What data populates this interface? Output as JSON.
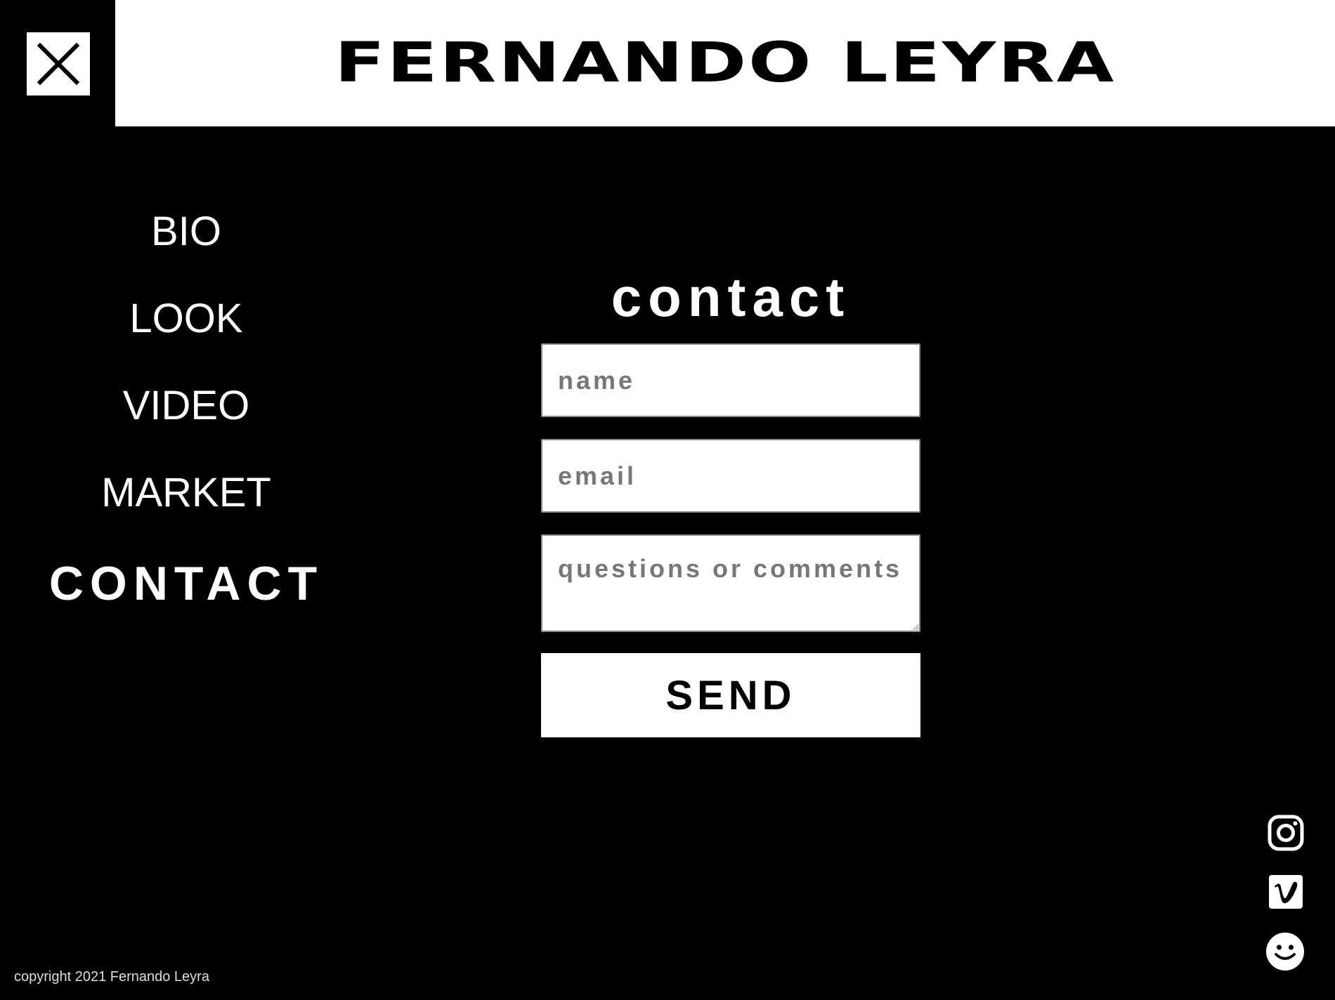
{
  "header": {
    "title": "FERNANDO LEYRA"
  },
  "nav": {
    "items": [
      {
        "label": "BIO"
      },
      {
        "label": "LOOK"
      },
      {
        "label": "VIDEO"
      },
      {
        "label": "MARKET"
      },
      {
        "label": "CONTACT"
      }
    ]
  },
  "contact_form": {
    "title": "contact",
    "name_placeholder": "name",
    "email_placeholder": "email",
    "comments_placeholder": "questions or comments",
    "send_label": "SEND"
  },
  "social": {
    "icons": [
      "instagram-icon",
      "vimeo-icon",
      "smiley-icon"
    ]
  },
  "footer": {
    "copyright": "copyright 2021 Fernando Leyra"
  },
  "colors": {
    "background": "#000000",
    "foreground": "#ffffff"
  }
}
